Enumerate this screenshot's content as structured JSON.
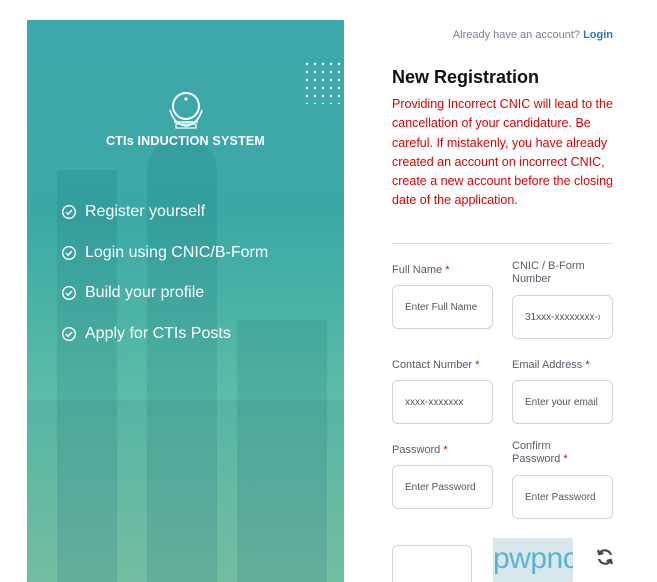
{
  "header": {
    "account_prompt": "Already have an account?",
    "login_link": "Login"
  },
  "left_panel": {
    "system_title": "CTIs INDUCTION SYSTEM",
    "features": [
      "Register yourself",
      "Login using CNIC/B-Form",
      "Build your profile",
      "Apply for CTIs Posts"
    ]
  },
  "form": {
    "title": "New Registration",
    "warning": "Providing Incorrect CNIC will lead to the cancellation of your candidature. Be careful. If mistakenly, you have already created an account on incorrect CNIC, create a new account before the closing date of the application.",
    "required_marker": "*",
    "fields": {
      "full_name": {
        "label": "Full Name",
        "placeholder": "Enter Full Name"
      },
      "cnic": {
        "label": "CNIC / B-Form Number",
        "placeholder": "31xxx-xxxxxxxx-x"
      },
      "contact": {
        "label": "Contact Number",
        "placeholder": "xxxx-xxxxxxx"
      },
      "email": {
        "label": "Email Address",
        "placeholder": "Enter your email"
      },
      "password": {
        "label": "Password",
        "placeholder": "Enter Password"
      },
      "confirm_password": {
        "label": "Confirm Password",
        "placeholder": "Enter Password"
      }
    },
    "captcha": {
      "text": "pwpnc"
    }
  },
  "icons": {
    "feature_check": "check-circle-icon",
    "refresh": "refresh-icon",
    "logo": "government-emblem-icon"
  },
  "colors": {
    "panel_teal": "#3fa8ad",
    "warning_red": "#e00000",
    "link_blue": "#2a7ab8"
  }
}
